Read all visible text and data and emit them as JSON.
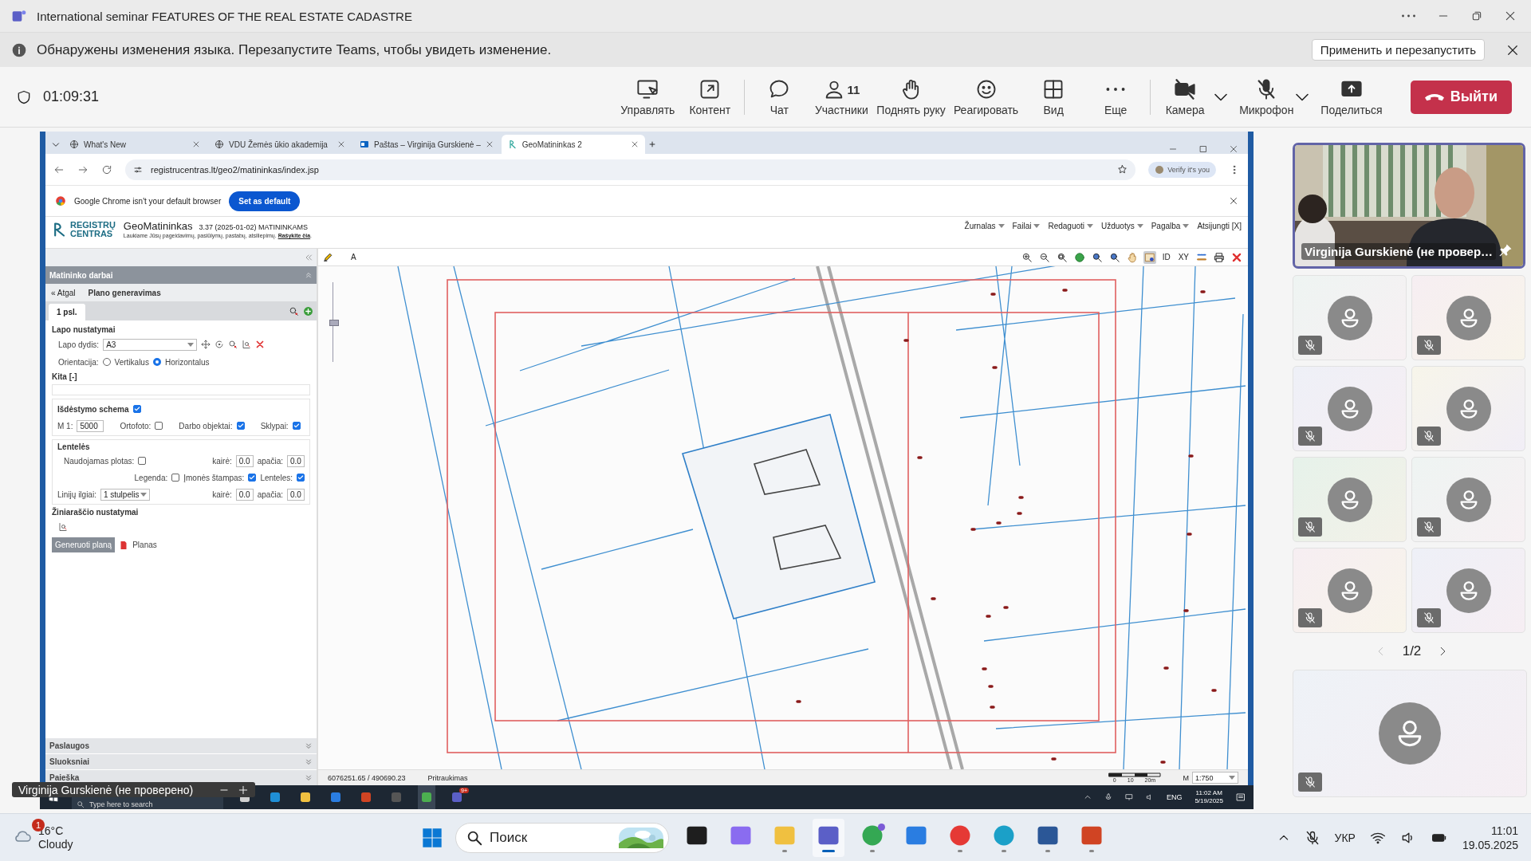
{
  "window": {
    "title": "International seminar FEATURES OF THE REAL ESTATE CADASTRE"
  },
  "notification": {
    "message": "Обнаружены изменения языка. Перезапустите Teams, чтобы увидеть изменение.",
    "action": "Применить и перезапустить"
  },
  "meeting_bar": {
    "timer": "01:09:31",
    "control_groups": [
      [
        {
          "kind": "present",
          "label": "Управлять"
        },
        {
          "kind": "content",
          "label": "Контент"
        }
      ],
      [
        {
          "kind": "chat",
          "label": "Чат"
        },
        {
          "kind": "people",
          "label": "Участники",
          "count": "11"
        },
        {
          "kind": "hand",
          "label": "Поднять руку"
        },
        {
          "kind": "react",
          "label": "Реагировать"
        },
        {
          "kind": "view",
          "label": "Вид"
        },
        {
          "kind": "more",
          "label": "Еще"
        }
      ],
      [
        {
          "kind": "camera",
          "label": "Камера",
          "off": true,
          "menu": true
        },
        {
          "kind": "mic",
          "label": "Микрофон",
          "off": true,
          "menu": true
        },
        {
          "kind": "share",
          "label": "Поделиться"
        }
      ]
    ],
    "leave": "Выйти"
  },
  "shared_screen": {
    "browser": {
      "tabs": [
        {
          "title": "What's New",
          "kind": "globe",
          "selected": false
        },
        {
          "title": "VDU Žemės ūkio akademija",
          "kind": "globe",
          "selected": false
        },
        {
          "title": "Paštas – Virginija Gurskienė –",
          "kind": "mail",
          "selected": false
        },
        {
          "title": "GeoMatininkas 2",
          "kind": "app",
          "selected": true
        }
      ],
      "url": "registrucentras.lt/geo2/matininkas/index.jsp",
      "profile": "Verify it's you",
      "infobar": {
        "message": "Google Chrome isn't your default browser",
        "button": "Set as default"
      }
    },
    "app": {
      "logo_lines": [
        "REGISTRŲ",
        "CENTRAS"
      ],
      "name": "GeoMatininkas",
      "version": "3.37 (2025-01-02) MATININKAMS",
      "feedback": "Laukiame Jūsų pageidavimų, pasiūlymų, pastabų, atsiliepimų.",
      "feedback_link": "Rašykite čia",
      "feedback_end": ".",
      "menu": [
        {
          "label": "Žurnalas",
          "dropdown": true
        },
        {
          "label": "Failai",
          "dropdown": true
        },
        {
          "label": "Redaguoti",
          "dropdown": true
        },
        {
          "label": "Užduotys",
          "dropdown": true
        },
        {
          "label": "Pagalba",
          "dropdown": true
        },
        {
          "label": "Atsijungti [X]",
          "dropdown": false
        }
      ]
    },
    "map_toolbar": {
      "left": [
        {
          "kind": "pencil"
        },
        {
          "kind": "label",
          "label": "A"
        }
      ],
      "tools": [
        {
          "kind": "zoom-in",
          "selected": false
        },
        {
          "kind": "zoom-out",
          "selected": false
        },
        {
          "kind": "zoom-box",
          "selected": false
        },
        {
          "kind": "globe",
          "selected": false
        },
        {
          "kind": "zoom-prev",
          "selected": false
        },
        {
          "kind": "zoom-next",
          "selected": false
        },
        {
          "kind": "pan",
          "selected": false
        },
        {
          "kind": "info",
          "selected": true
        },
        {
          "kind": "label",
          "label": "ID",
          "selected": false
        },
        {
          "kind": "label",
          "label": "XY",
          "selected": false
        },
        {
          "kind": "layers",
          "selected": false
        },
        {
          "kind": "print",
          "selected": false
        },
        {
          "kind": "close",
          "selected": false
        }
      ]
    },
    "panel": {
      "title": "Matininko darbai",
      "back": "« Atgal",
      "heading": "Plano generavimas",
      "tabs": [
        {
          "label": "1 psl.",
          "selected": true
        }
      ],
      "page_settings": {
        "title": "Lapo nustatymai",
        "size_label": "Lapo dydis:",
        "size": "A3",
        "orientation_label": "Orientacija:",
        "orientations": [
          {
            "label": "Vertikalus",
            "selected": false
          },
          {
            "label": "Horizontalus",
            "selected": true
          }
        ],
        "other": "Kita [-]"
      },
      "layout_scheme": {
        "title": "Išdėstymo schema",
        "checked": true,
        "scale_label": "M 1:",
        "scale": "5000",
        "options": [
          {
            "label": "Ortofoto:",
            "checked": false
          },
          {
            "label": "Darbo objektai:",
            "checked": true
          },
          {
            "label": "Sklypai:",
            "checked": true
          }
        ]
      },
      "tables": {
        "title": "Lentelės",
        "used_area": {
          "label": "Naudojamas plotas:",
          "checked": false
        },
        "offsets_top": [
          {
            "label": "kairė:",
            "value": "0.0"
          },
          {
            "label": "apačia:",
            "value": "0.0"
          }
        ],
        "options": [
          {
            "label": "Legenda:",
            "checked": false
          },
          {
            "label": "Įmonės štampas:",
            "checked": true
          },
          {
            "label": "Lenteles:",
            "checked": true
          }
        ],
        "line_lengths_label": "Linijų ilgiai:",
        "line_lengths": "1 stulpelis",
        "offsets_bottom": [
          {
            "label": "kairė:",
            "value": "0.0"
          },
          {
            "label": "apačia:",
            "value": "0.0"
          }
        ]
      },
      "register_title": "Žiniaraščio nustatymai",
      "generate": "Generuoti planą",
      "pdf": "Planas",
      "accordions": [
        "Paslaugos",
        "Sluoksniai",
        "Paieška"
      ]
    },
    "zoom_slider": {
      "level": 0.5
    },
    "status_bar": {
      "coordinates": "6076251.65 / 490690.23",
      "mode": "Pritraukimas",
      "scale_ticks": [
        "0",
        "10",
        "20m"
      ],
      "scale_label": "M",
      "scale": "1:750"
    },
    "taskbar": {
      "search": "Type here to search",
      "apps": [
        {
          "kind": "taskview",
          "selected": false
        },
        {
          "kind": "edge",
          "selected": false
        },
        {
          "kind": "folder",
          "selected": false
        },
        {
          "kind": "store",
          "selected": false
        },
        {
          "kind": "powerpoint",
          "selected": false
        },
        {
          "kind": "player",
          "selected": false
        },
        {
          "kind": "chrome",
          "selected": true
        },
        {
          "kind": "teams",
          "selected": false,
          "badge": "9+"
        }
      ],
      "language": "ENG",
      "time": "11:02 AM",
      "date": "5/19/2025"
    }
  },
  "floating_label": {
    "name": "Virginija Gurskienė (не проверено)"
  },
  "participants": {
    "featured": {
      "name": "Virginija Gurskienė (не провер…",
      "pinned": true
    },
    "tiles": [
      {
        "muted": true
      },
      {
        "muted": true
      },
      {
        "muted": true
      },
      {
        "muted": true
      },
      {
        "muted": true
      },
      {
        "muted": true
      },
      {
        "muted": true
      },
      {
        "muted": true
      }
    ],
    "pager": "1/2",
    "pager_prev": {
      "disabled": true
    },
    "pager_next": {
      "disabled": false
    },
    "self": {
      "muted": true
    }
  },
  "taskbar": {
    "weather": {
      "temperature": "16°C",
      "condition": "Cloudy",
      "badge": "1"
    },
    "search": "Поиск",
    "apps": [
      {
        "kind": "square",
        "selected": false,
        "running": false
      },
      {
        "kind": "copilot",
        "selected": false,
        "running": false
      },
      {
        "kind": "folder",
        "selected": false,
        "running": true
      },
      {
        "kind": "teams",
        "selected": true,
        "running": true
      },
      {
        "kind": "chrome",
        "selected": false,
        "running": true,
        "notified": true
      },
      {
        "kind": "store",
        "selected": false,
        "running": false
      },
      {
        "kind": "yandex",
        "selected": false,
        "running": true
      },
      {
        "kind": "edge",
        "selected": false,
        "running": true
      },
      {
        "kind": "word",
        "selected": false,
        "running": true
      },
      {
        "kind": "powerpoint",
        "selected": false,
        "running": true
      }
    ],
    "tray": {
      "language": "УКР",
      "time": "11:01",
      "date": "19.05.2025"
    }
  }
}
